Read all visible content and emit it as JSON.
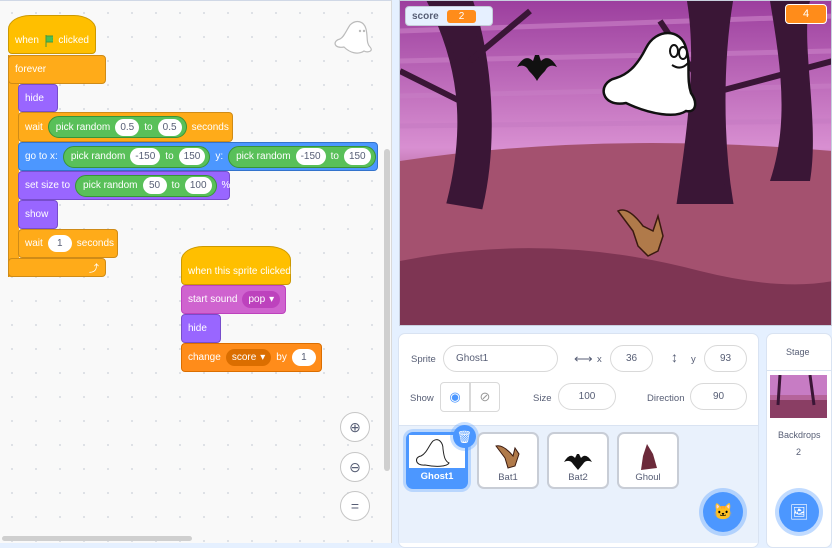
{
  "colors": {
    "events": "#ffbf00",
    "control": "#ffab19",
    "looks": "#9966ff",
    "motion": "#4c97ff",
    "sound": "#cf63cf",
    "variables": "#ff8c1a",
    "operators": "#59c059",
    "accent": "#4c97ff"
  },
  "script1": {
    "hat": {
      "when": "when",
      "icon": "green-flag-icon",
      "clicked": "clicked"
    },
    "forever": "forever",
    "hide": "hide",
    "wait1": {
      "wait": "wait",
      "pick": "pick random",
      "from": "0.5",
      "to": "to",
      "to_val": "0.5",
      "unit": "seconds"
    },
    "goto": {
      "label": "go to x:",
      "pick": "pick random",
      "x_from": "-150",
      "to": "to",
      "x_to": "150",
      "y": "y:",
      "y_from": "-150",
      "y_to": "150"
    },
    "setsize": {
      "label": "set size to",
      "pick": "pick random",
      "from": "50",
      "to": "to",
      "to_val": "100",
      "unit": "%"
    },
    "show": "show",
    "wait2": {
      "wait": "wait",
      "value": "1",
      "unit": "seconds"
    }
  },
  "script2": {
    "hat": "when this sprite clicked",
    "sound": {
      "label": "start sound",
      "value": "pop"
    },
    "hide": "hide",
    "change": {
      "label": "change",
      "var": "score",
      "by": "by",
      "value": "1"
    }
  },
  "stage": {
    "monitor_label": "score",
    "monitor_value": "2",
    "counter": "4"
  },
  "sprite_info": {
    "sprite_label": "Sprite",
    "name": "Ghost1",
    "x_label": "x",
    "x": "36",
    "y_label": "y",
    "y": "93",
    "show_label": "Show",
    "size_label": "Size",
    "size": "100",
    "direction_label": "Direction",
    "direction": "90"
  },
  "sprites": [
    {
      "name": "Ghost1",
      "selected": true
    },
    {
      "name": "Bat1"
    },
    {
      "name": "Bat2"
    },
    {
      "name": "Ghoul"
    }
  ],
  "stage_pane": {
    "title": "Stage",
    "backdrops_label": "Backdrops",
    "backdrops_count": "2"
  }
}
